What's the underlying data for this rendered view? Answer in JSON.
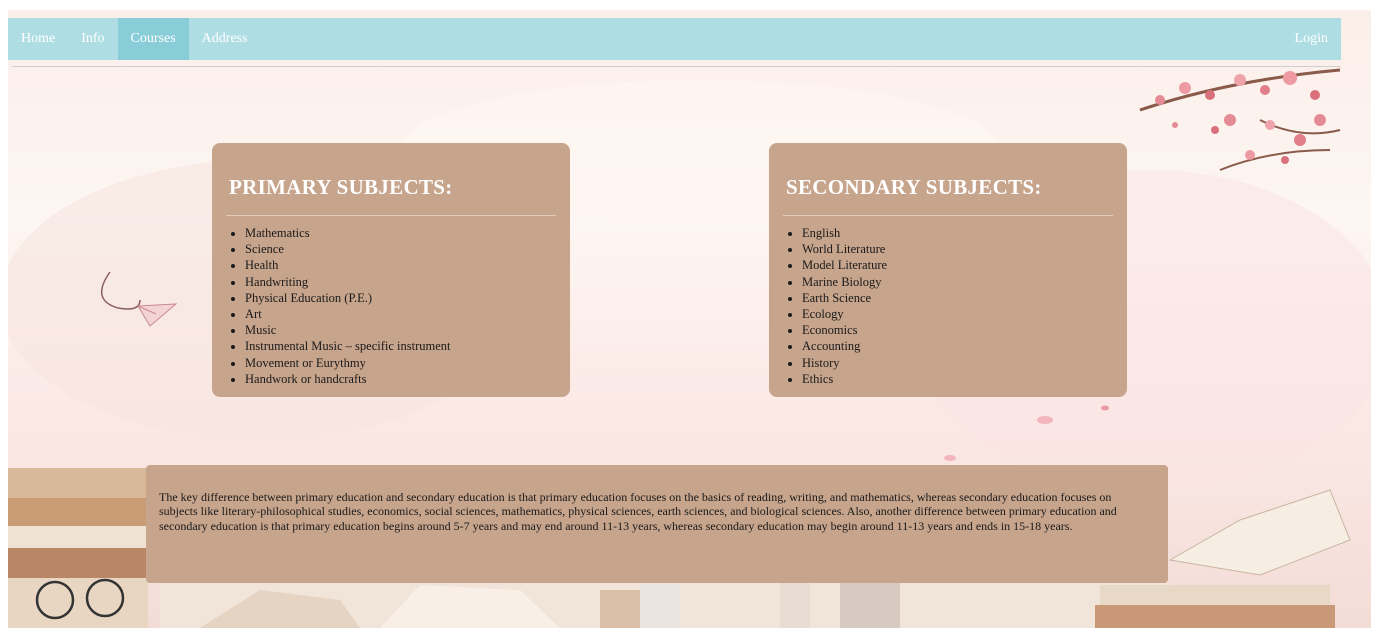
{
  "nav": {
    "items": [
      {
        "label": "Home",
        "active": false
      },
      {
        "label": "Info",
        "active": false
      },
      {
        "label": "Courses",
        "active": true
      },
      {
        "label": "Address",
        "active": false
      }
    ],
    "login_label": "Login"
  },
  "primary": {
    "title": "PRIMARY SUBJECTS:",
    "items": [
      "Mathematics",
      "Science",
      "Health",
      "Handwriting",
      "Physical Education (P.E.)",
      "Art",
      "Music",
      "Instrumental Music – specific instrument",
      "Movement or Eurythmy",
      "Handwork or handcrafts"
    ]
  },
  "secondary": {
    "title": "SECONDARY SUBJECTS:",
    "items": [
      "English",
      "World Literature",
      "Model Literature",
      "Marine Biology",
      "Earth Science",
      "Ecology",
      "Economics",
      "Accounting",
      "History",
      "Ethics"
    ]
  },
  "info": {
    "text": "The key difference between primary education and secondary education is that primary education focuses on the basics of reading, writing, and mathematics, whereas secondary education focuses on subjects like literary-philosophical studies, economics, social sciences, mathematics, physical sciences, earth sciences, and biological sciences. Also, another difference between primary education and secondary education is that primary education begins around 5-7 years and may end around 11-13 years, whereas secondary education may begin around 11-13 years and ends in 15-18 years."
  },
  "colors": {
    "nav_bg": "#aedee4",
    "nav_active": "#89cdd9",
    "card_bg": "#c7a48c"
  }
}
